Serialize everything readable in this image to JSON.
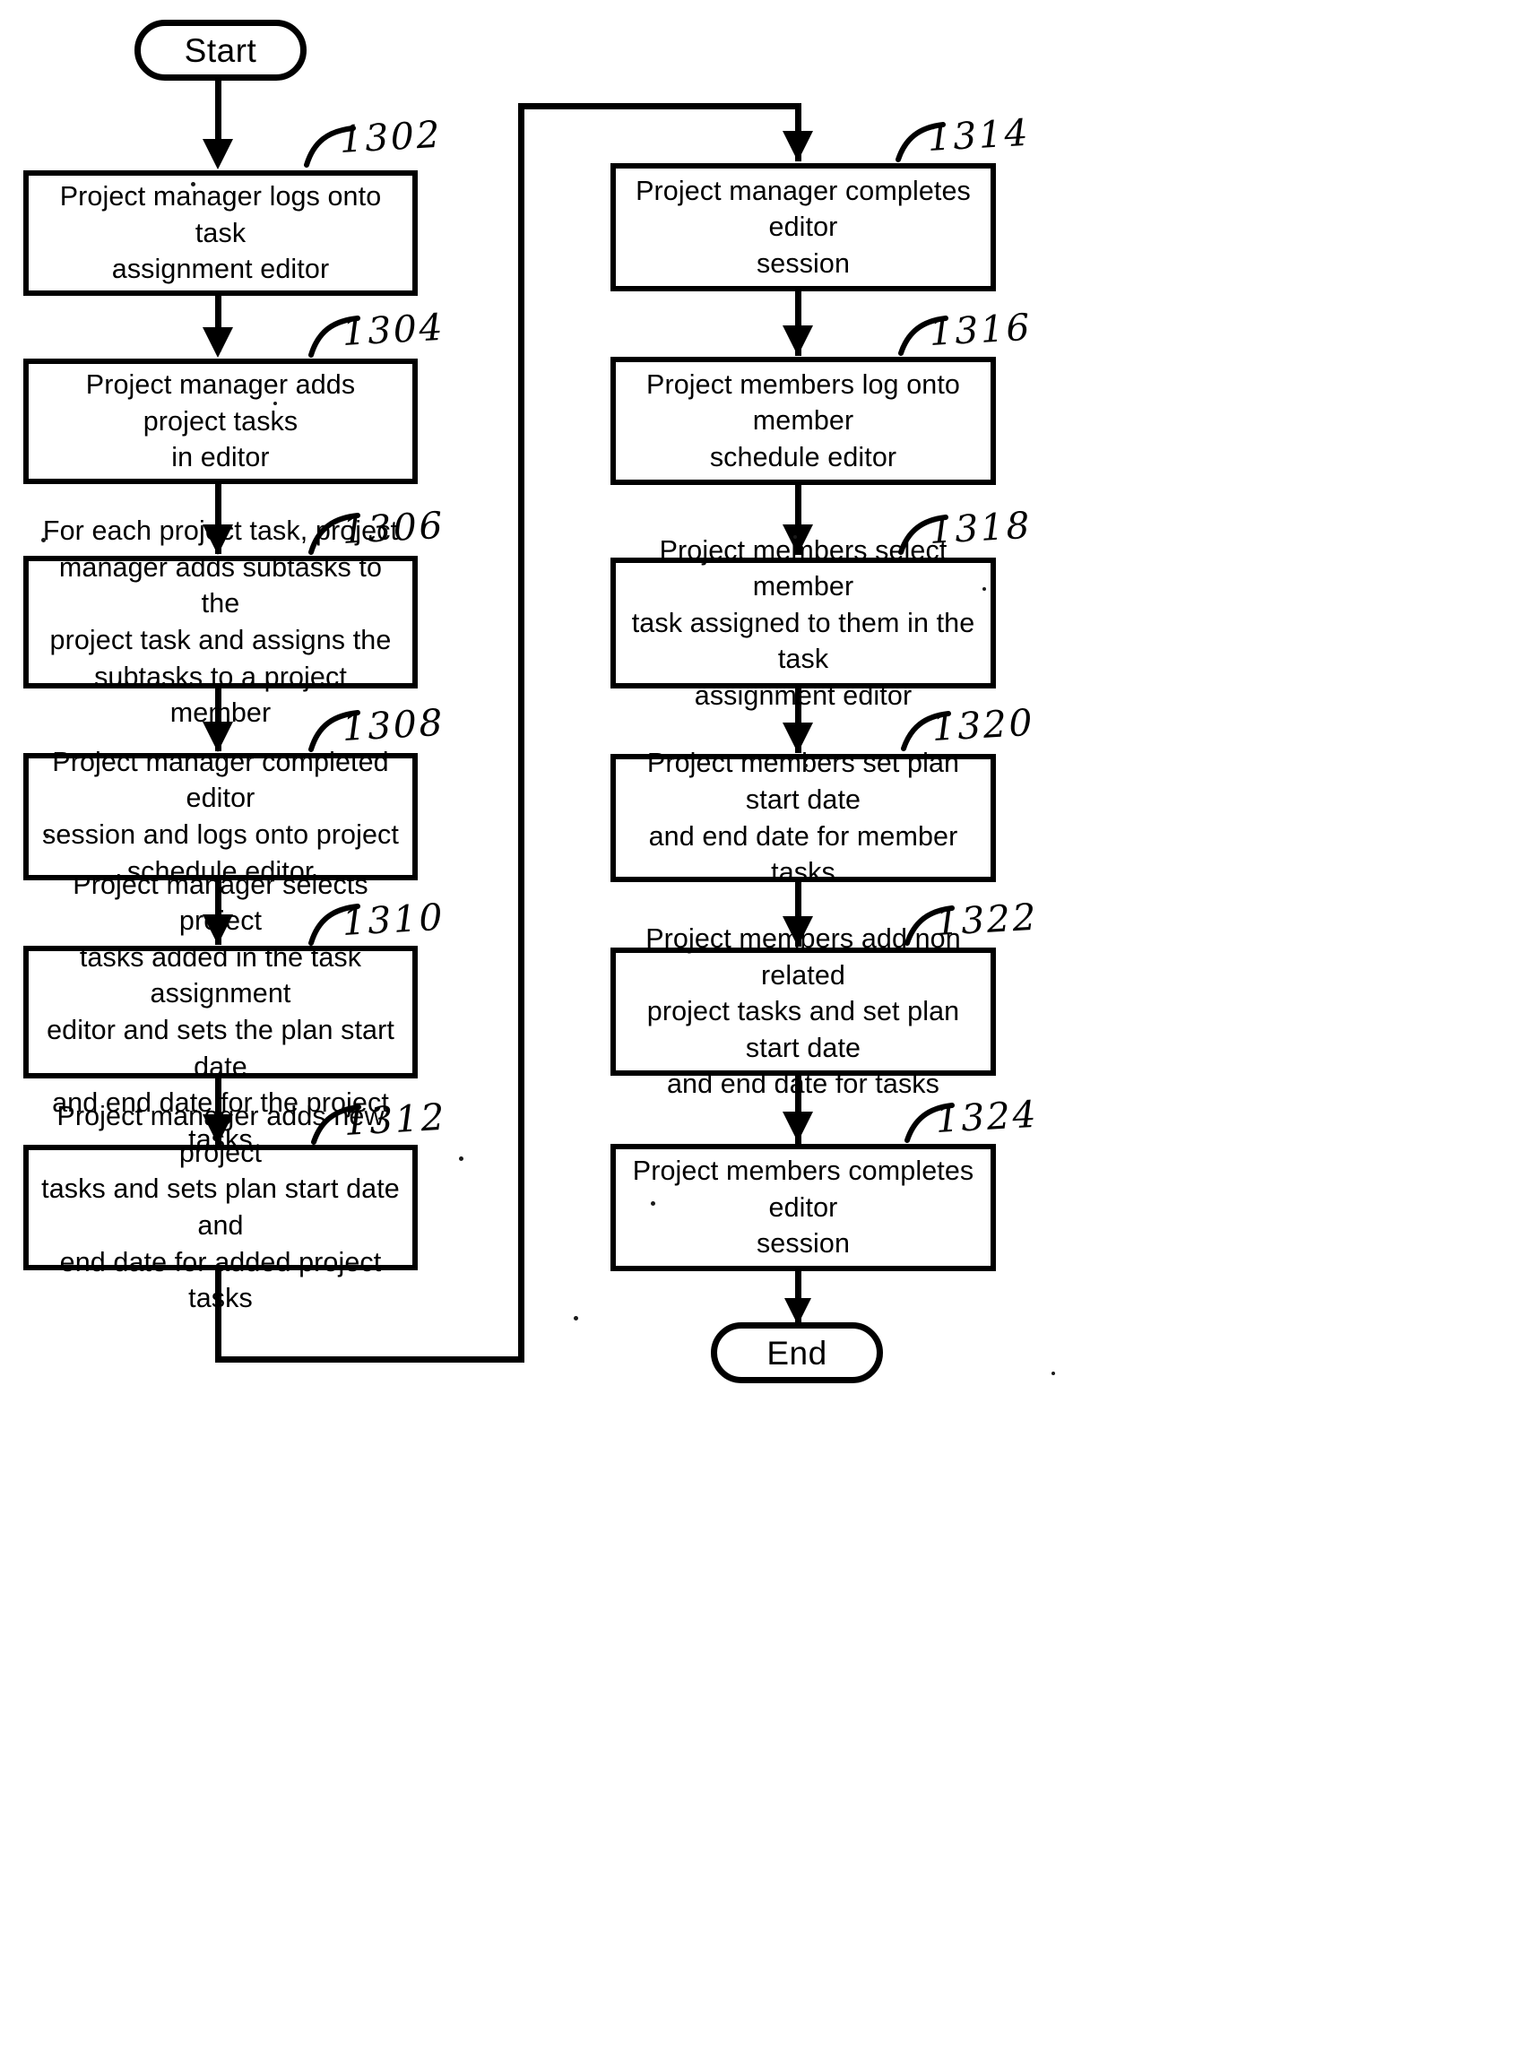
{
  "figure": {
    "type": "flowchart",
    "orientation": "two-column",
    "terminals": {
      "start": "Start",
      "end": "End"
    },
    "columns": [
      {
        "name": "left-column",
        "steps": [
          {
            "ref": "1302",
            "text": "Project manager logs onto task\nassignment editor"
          },
          {
            "ref": "1304",
            "text": "Project manager adds project tasks\nin editor"
          },
          {
            "ref": "1306",
            "text": "For each project task, project\nmanager adds subtasks to the\nproject task and assigns the\nsubtasks to a project member"
          },
          {
            "ref": "1308",
            "text": "Project manager completed editor\nsession and logs onto project\nschedule editor"
          },
          {
            "ref": "1310",
            "text": "Project manager selects project\ntasks added in the task assignment\neditor and sets the plan start date\nand end date for the project tasks"
          },
          {
            "ref": "1312",
            "text": "Project manager adds new project\ntasks and sets plan start date and\nend date for added project tasks"
          }
        ]
      },
      {
        "name": "right-column",
        "steps": [
          {
            "ref": "1314",
            "text": "Project manager completes editor\nsession"
          },
          {
            "ref": "1316",
            "text": "Project members log onto member\nschedule editor"
          },
          {
            "ref": "1318",
            "text": "Project members select member\ntask assigned to them in the task\nassignment editor"
          },
          {
            "ref": "1320",
            "text": "Project members set plan start date\nand end date for member tasks"
          },
          {
            "ref": "1322",
            "text": "Project members add non related\nproject tasks and set plan start date\nand end date for tasks"
          },
          {
            "ref": "1324",
            "text": "Project members completes editor\nsession"
          }
        ]
      }
    ],
    "colors": {
      "ink": "#000000",
      "paper": "#ffffff"
    }
  }
}
